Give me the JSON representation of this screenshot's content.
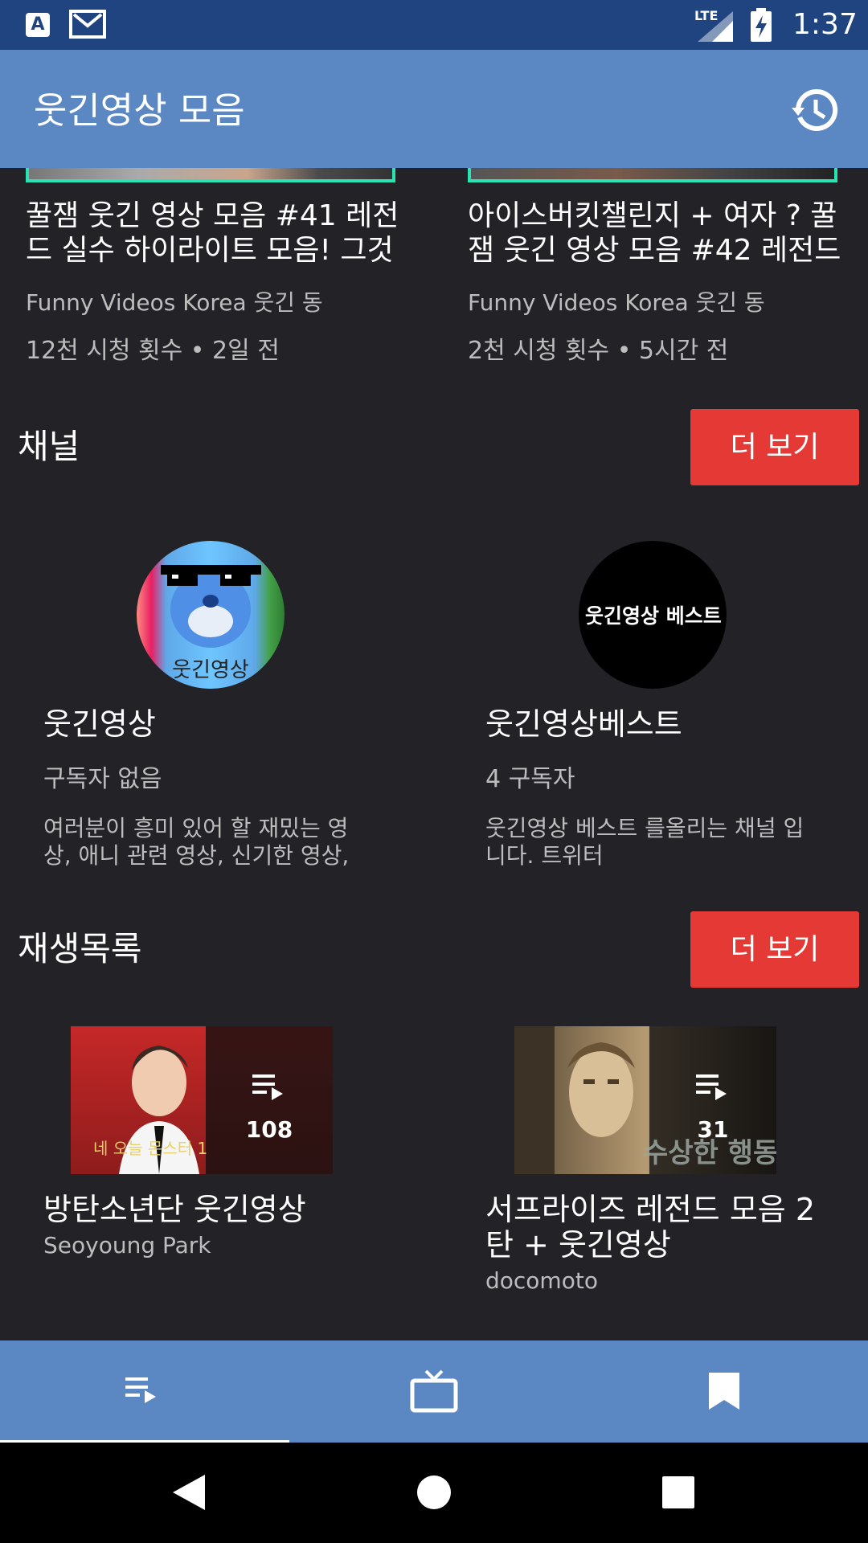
{
  "status_bar": {
    "network": "LTE",
    "time": "1:37",
    "keyboard_badge": "A"
  },
  "app_bar": {
    "title": "웃긴영상 모음"
  },
  "videos": [
    {
      "title": "꿀잼 웃긴 영상 모음 #41 레전드 실수 하이라이트 모음! 그것",
      "channel": "Funny Videos Korea 웃긴 동",
      "meta": "12천 시청 횟수 • 2일 전"
    },
    {
      "title": "아이스버킷챌린지 + 여자 ? 꿀잼 웃긴 영상 모음 #42 레전드",
      "channel": "Funny Videos Korea 웃긴 동",
      "meta": "2천 시청 횟수 • 5시간 전"
    }
  ],
  "channels_section": {
    "title": "채널",
    "more_label": "더 보기",
    "items": [
      {
        "avatar_text": "웃긴영상",
        "name": "웃긴영상",
        "subs": "구독자 없음",
        "desc": "여러분이 흥미 있어 할 재밌는 영상, 애니 관련 영상, 신기한 영상, ..."
      },
      {
        "avatar_text": "웃긴영상 베스트",
        "name": "웃긴영상베스트",
        "subs": "4 구독자",
        "desc": "웃긴영상 베스트 를올리는 채널 입니다. 트위터https://twitter.com/..."
      }
    ]
  },
  "playlists_section": {
    "title": "재생목록",
    "more_label": "더 보기",
    "items": [
      {
        "count": "108",
        "title": "방탄소년단 웃긴영상",
        "author": "Seoyoung Park",
        "thumb_caption": "네 오늘 몬스터 1"
      },
      {
        "count": "31",
        "title": "서프라이즈 레전드 모음 2탄 + 웃긴영상",
        "author": "docomoto",
        "thumb_caption": "수상한 행동"
      }
    ]
  },
  "bottom_nav": {
    "tabs": [
      {
        "icon": "playlist-icon",
        "selected": true
      },
      {
        "icon": "tv-icon",
        "selected": false
      },
      {
        "icon": "bookmark-icon",
        "selected": false
      }
    ]
  },
  "system_nav": {
    "buttons": [
      "back-icon",
      "home-icon",
      "recents-icon"
    ]
  },
  "colors": {
    "status_bar": "#1f4480",
    "app_bar": "#5b87c2",
    "background": "#232226",
    "accent_button": "#e53935",
    "thumb_border": "#29e3b4"
  }
}
